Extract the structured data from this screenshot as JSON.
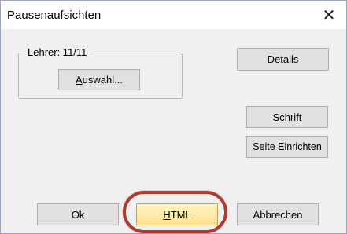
{
  "window": {
    "title": "Pausenaufsichten",
    "close_glyph": "✕"
  },
  "group": {
    "label": "Lehrer: 11/11"
  },
  "buttons": {
    "auswahl_mnemonic": "A",
    "auswahl_rest": "uswahl...",
    "details": "Details",
    "schrift": "Schrift",
    "seite_einrichten": "Seite Einrichten",
    "ok": "Ok",
    "html_mnemonic": "H",
    "html_rest": "TML",
    "abbrechen": "Abbrechen"
  },
  "colors": {
    "highlight_ring": "#b03a2e",
    "default_button": "#ffe391"
  }
}
